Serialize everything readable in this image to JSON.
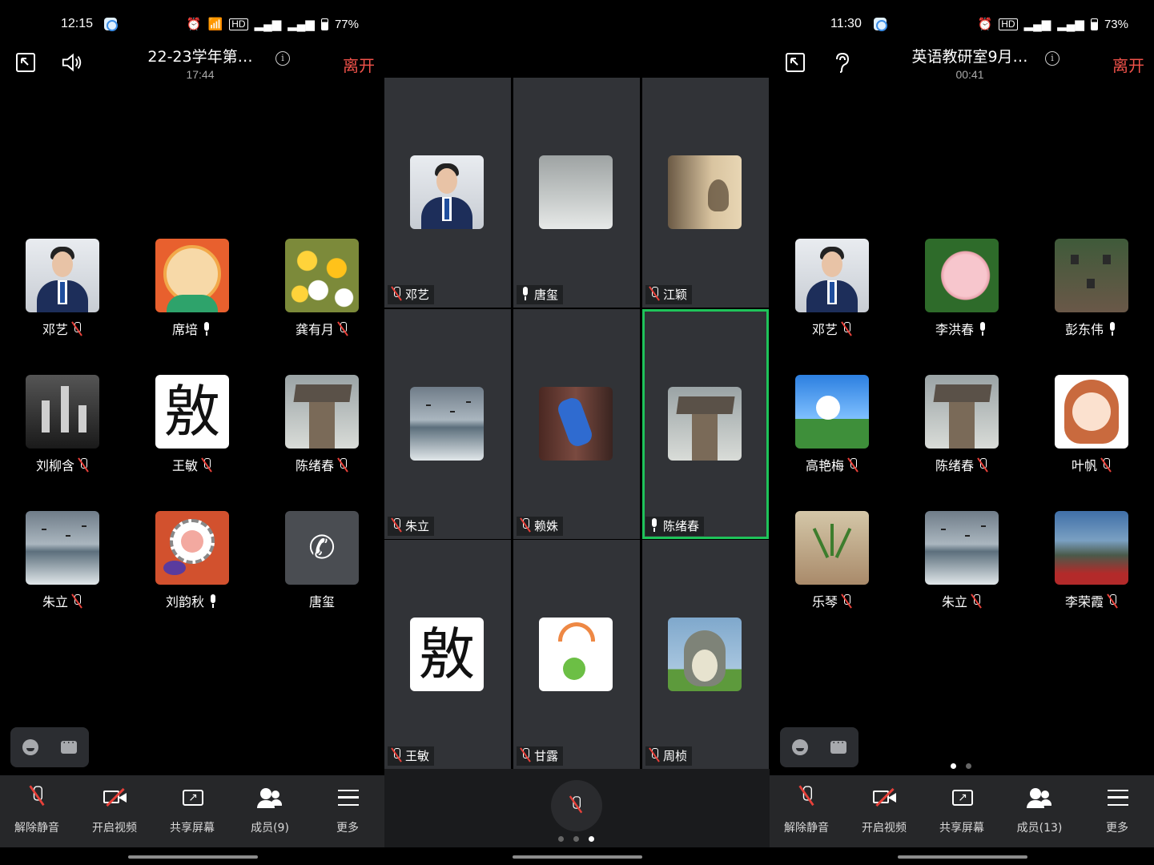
{
  "left": {
    "status": {
      "time": "12:15",
      "battery": "77%",
      "icons": [
        "alarm-icon",
        "wifi-icon",
        "hd-icon",
        "4g-signal-icon",
        "4g-signal-icon",
        "battery-icon"
      ]
    },
    "topbar": {
      "title": "22-23学年第…",
      "timer": "17:44",
      "leave": "离开",
      "speaker_icon": "speaker-icon",
      "minimize_icon": "minimize-window-icon"
    },
    "participants": [
      {
        "name": "邓艺",
        "mic": "off",
        "avatar": "person"
      },
      {
        "name": "席培",
        "mic": "on",
        "avatar": "cartoon"
      },
      {
        "name": "龚有月",
        "mic": "off",
        "avatar": "flowers"
      },
      {
        "name": "刘柳含",
        "mic": "off",
        "avatar": "city"
      },
      {
        "name": "王敏",
        "mic": "off",
        "avatar": "calligraphy"
      },
      {
        "name": "陈绪春",
        "mic": "off",
        "avatar": "pillar"
      },
      {
        "name": "朱立",
        "mic": "off",
        "avatar": "sea"
      },
      {
        "name": "刘韵秋",
        "mic": "on",
        "avatar": "sunflower"
      },
      {
        "name": "唐玺",
        "mic": "none",
        "avatar": "phone"
      }
    ],
    "toolbar": [
      {
        "label": "解除静音",
        "icon": "mic-muted-icon"
      },
      {
        "label": "开启视频",
        "icon": "video-off-icon"
      },
      {
        "label": "共享屏幕",
        "icon": "share-screen-icon"
      },
      {
        "label": "成员(9)",
        "icon": "members-icon"
      },
      {
        "label": "更多",
        "icon": "menu-icon"
      }
    ]
  },
  "mid": {
    "tiles": [
      {
        "name": "邓艺",
        "mic": "off",
        "avatar": "person",
        "active": false
      },
      {
        "name": "唐玺",
        "mic": "on",
        "avatar": "snow",
        "active": false
      },
      {
        "name": "江颖",
        "mic": "off",
        "avatar": "lamp",
        "active": false
      },
      {
        "name": "朱立",
        "mic": "off",
        "avatar": "sea",
        "active": false
      },
      {
        "name": "赖姝",
        "mic": "off",
        "avatar": "dancer",
        "active": false
      },
      {
        "name": "陈绪春",
        "mic": "on",
        "avatar": "pillar",
        "active": true
      },
      {
        "name": "王敏",
        "mic": "off",
        "avatar": "calligraphy",
        "active": false
      },
      {
        "name": "甘露",
        "mic": "off",
        "avatar": "kids",
        "active": false
      },
      {
        "name": "周桢",
        "mic": "off",
        "avatar": "totoro",
        "active": false
      }
    ],
    "page_indicator": {
      "pages": 3,
      "current": 3
    }
  },
  "right": {
    "status": {
      "time": "11:30",
      "battery": "73%",
      "icons": [
        "alarm-icon",
        "hd-icon",
        "4g-signal-icon",
        "4g-signal-icon",
        "battery-icon"
      ]
    },
    "topbar": {
      "title": "英语教研室9月…",
      "timer": "00:41",
      "leave": "离开",
      "earpiece_icon": "ear-icon",
      "minimize_icon": "minimize-window-icon"
    },
    "participants": [
      {
        "name": "邓艺",
        "mic": "off",
        "avatar": "person"
      },
      {
        "name": "李洪春",
        "mic": "on",
        "avatar": "rose"
      },
      {
        "name": "彭东伟",
        "mic": "on",
        "avatar": "house"
      },
      {
        "name": "高艳梅",
        "mic": "off",
        "avatar": "dandelion"
      },
      {
        "name": "陈绪春",
        "mic": "off",
        "avatar": "pillar"
      },
      {
        "name": "叶帆",
        "mic": "off",
        "avatar": "girl"
      },
      {
        "name": "乐琴",
        "mic": "off",
        "avatar": "plant"
      },
      {
        "name": "朱立",
        "mic": "off",
        "avatar": "sea"
      },
      {
        "name": "李荣霞",
        "mic": "off",
        "avatar": "mountain"
      }
    ],
    "page_indicator": {
      "pages": 2,
      "current": 1
    },
    "toolbar": [
      {
        "label": "解除静音",
        "icon": "mic-muted-icon"
      },
      {
        "label": "开启视频",
        "icon": "video-off-icon"
      },
      {
        "label": "共享屏幕",
        "icon": "share-screen-icon"
      },
      {
        "label": "成员(13)",
        "icon": "members-icon"
      },
      {
        "label": "更多",
        "icon": "menu-icon"
      }
    ]
  },
  "colors": {
    "leave": "#f0524a",
    "active_speaker": "#1fc35a",
    "mute_slash": "#e8413a",
    "toolbar_bg": "#262729",
    "tile_bg": "#313337"
  },
  "calligraphy_glyph": "敫"
}
